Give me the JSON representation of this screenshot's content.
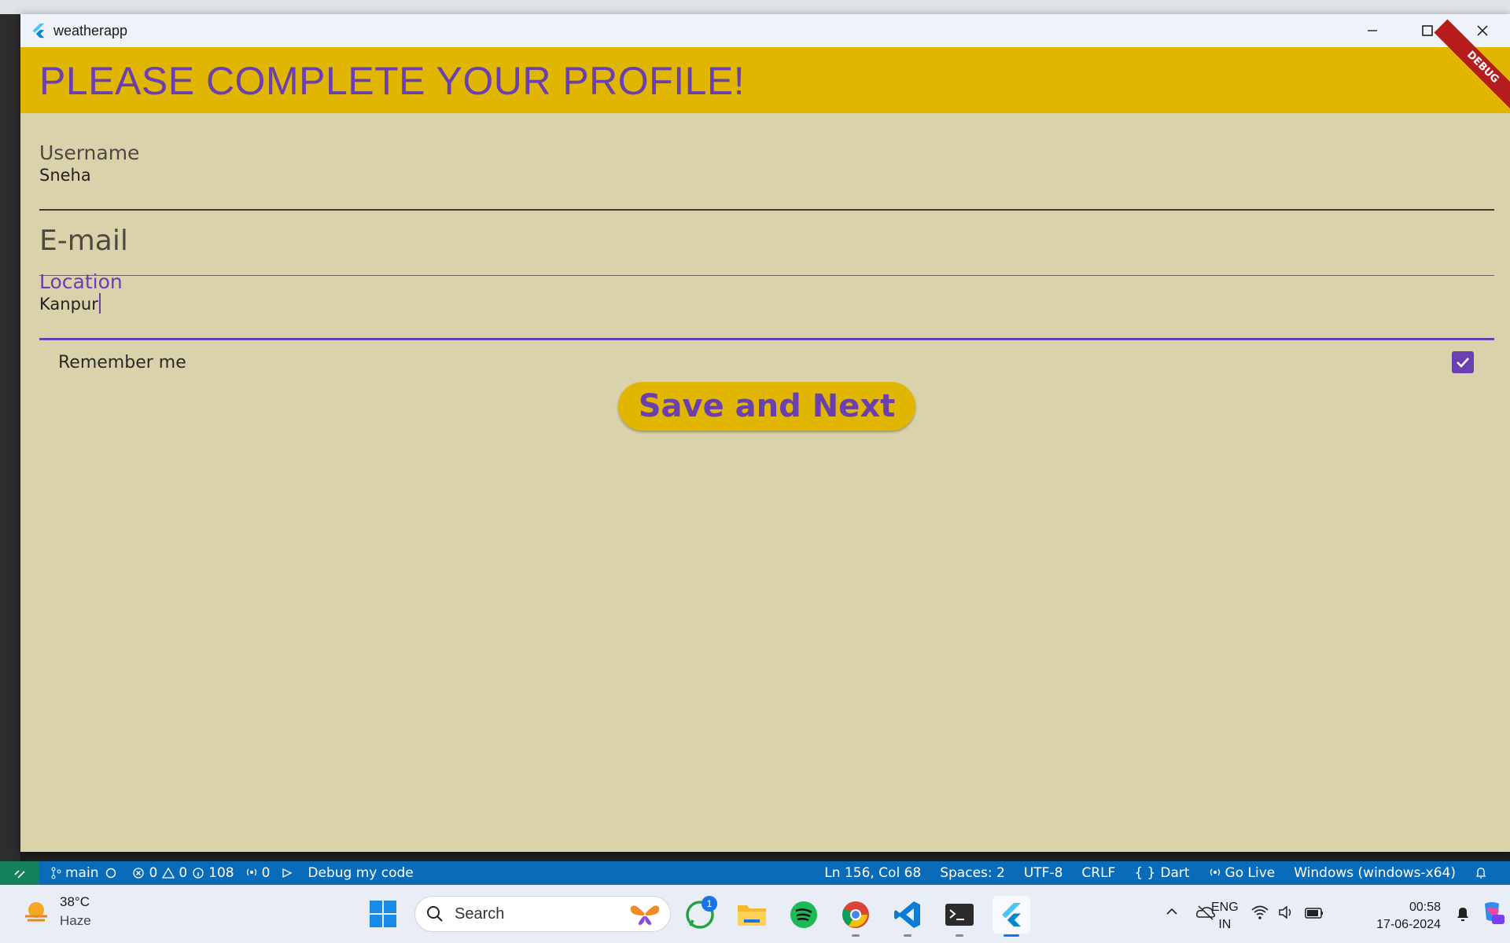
{
  "window": {
    "title": "weatherapp"
  },
  "appbar": {
    "title": "PLEASE COMPLETE YOUR PROFILE!",
    "debug_banner": "DEBUG"
  },
  "form": {
    "username": {
      "label": "Username",
      "value": "Sneha"
    },
    "email": {
      "label": "E-mail",
      "value": ""
    },
    "location": {
      "label": "Location",
      "value": "Kanpur"
    },
    "remember": {
      "label": "Remember me",
      "checked": true
    },
    "submit_label": "Save and Next"
  },
  "statusbar": {
    "branch": "main",
    "errors": "0",
    "warnings": "0",
    "infos": "108",
    "ports": "0",
    "debug_label": "Debug my code",
    "cursor": "Ln 156, Col 68",
    "spaces": "Spaces: 2",
    "encoding": "UTF-8",
    "eol": "CRLF",
    "language": "Dart",
    "golive": "Go Live",
    "platform": "Windows (windows-x64)"
  },
  "taskbar": {
    "weather_temp": "38°C",
    "weather_cond": "Haze",
    "search_placeholder": "Search",
    "whatsapp_badge": "1",
    "lang_1": "ENG",
    "lang_2": "IN",
    "time": "00:58",
    "date": "17-06-2024"
  },
  "colors": {
    "appbar": "#e1b600",
    "accent": "#6a3fb0",
    "background": "#dad2ab",
    "statusbar": "#0a6bb8"
  }
}
